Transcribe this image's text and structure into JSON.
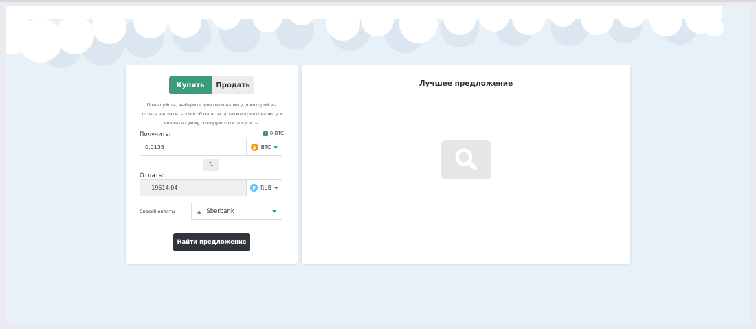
{
  "exchange": {
    "tabs": {
      "buy_label": "Купить",
      "sell_label": "Продать"
    },
    "hint": "Пожалуйста, выберите фиатную валюту, в которой вы хотите заплатить, способ оплаты, а также криптовалюту и введите сумму, которую хотите купить.",
    "receive": {
      "label": "Получить:",
      "balance": "0 BTC",
      "amount": "0.0135",
      "currency": "BTC",
      "currency_icon": "bitcoin-icon"
    },
    "give": {
      "label": "Отдать:",
      "amount": "~ 19614.04",
      "currency": "RUB",
      "currency_icon": "ruble-icon"
    },
    "payment": {
      "label": "Способ оплаты",
      "method": "Sberbank"
    },
    "find_button": "Найти предложение"
  },
  "best_offer": {
    "title": "Лучшее предложение",
    "placeholder_icon": "search-icon"
  },
  "colors": {
    "accent": "#3a9c7c",
    "dark_button": "#2f353a",
    "page_background": "#e8f0f8",
    "btc": "#f0931c",
    "rub": "#5bc4f0"
  }
}
